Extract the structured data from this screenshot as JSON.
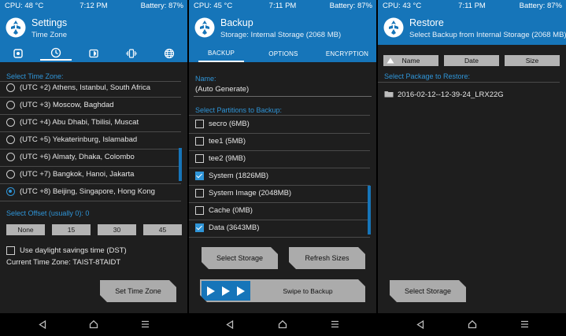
{
  "panels": {
    "settings": {
      "status": {
        "cpu": "CPU: 48 °C",
        "time": "7:12 PM",
        "battery": "Battery: 87%"
      },
      "title": "Settings",
      "subtitle": "Time Zone",
      "tab_icons": [
        "chip-icon",
        "clock-icon",
        "screen-icon",
        "vibrate-icon",
        "globe-icon"
      ],
      "active_tab": 1,
      "select_label": "Select Time Zone:",
      "zones": [
        {
          "label": "(UTC +2) Athens, Istanbul, South Africa",
          "selected": false
        },
        {
          "label": "(UTC +3) Moscow, Baghdad",
          "selected": false
        },
        {
          "label": "(UTC +4) Abu Dhabi, Tbilisi, Muscat",
          "selected": false
        },
        {
          "label": "(UTC +5) Yekaterinburg, Islamabad",
          "selected": false
        },
        {
          "label": "(UTC +6) Almaty, Dhaka, Colombo",
          "selected": false
        },
        {
          "label": "(UTC +7) Bangkok, Hanoi, Jakarta",
          "selected": false
        },
        {
          "label": "(UTC +8) Beijing, Singapore, Hong Kong",
          "selected": true
        }
      ],
      "offset_label": "Select Offset (usually 0): 0",
      "offsets": [
        "None",
        "15",
        "30",
        "45"
      ],
      "dst_label": "Use daylight savings time (DST)",
      "dst_checked": false,
      "current_zone": "Current Time Zone: TAIST-8TAIDT",
      "set_button": "Set Time Zone"
    },
    "backup": {
      "status": {
        "cpu": "CPU: 45 °C",
        "time": "7:11 PM",
        "battery": "Battery: 87%"
      },
      "title": "Backup",
      "subtitle": "Storage: Internal Storage (2068 MB)",
      "tabs": [
        "BACKUP",
        "OPTIONS",
        "ENCRYPTION"
      ],
      "active_tab": 0,
      "name_label": "Name:",
      "name_value": "(Auto Generate)",
      "partitions_label": "Select Partitions to Backup:",
      "partitions": [
        {
          "label": "secro (6MB)",
          "checked": false
        },
        {
          "label": "tee1 (5MB)",
          "checked": false
        },
        {
          "label": "tee2 (9MB)",
          "checked": false
        },
        {
          "label": "System (1826MB)",
          "checked": true
        },
        {
          "label": "System Image (2048MB)",
          "checked": false
        },
        {
          "label": "Cache (0MB)",
          "checked": false
        },
        {
          "label": "Data (3643MB)",
          "checked": true
        }
      ],
      "select_storage_button": "Select Storage",
      "refresh_sizes_button": "Refresh Sizes",
      "swipe_label": "Swipe to Backup"
    },
    "restore": {
      "status": {
        "cpu": "CPU: 43 °C",
        "time": "7:11 PM",
        "battery": "Battery: 87%"
      },
      "title": "Restore",
      "subtitle": "Select Backup from Internal Storage (2068 MB)",
      "sort_buttons": [
        "Name",
        "Date",
        "Size"
      ],
      "package_label": "Select Package to Restore:",
      "packages": [
        "2016-02-12--12-39-24_LRX22G"
      ],
      "select_storage_button": "Select Storage"
    }
  },
  "colors": {
    "accent": "#1675b9",
    "highlight": "#2f95d8",
    "background": "#1e1e1e",
    "button": "#ababab"
  }
}
